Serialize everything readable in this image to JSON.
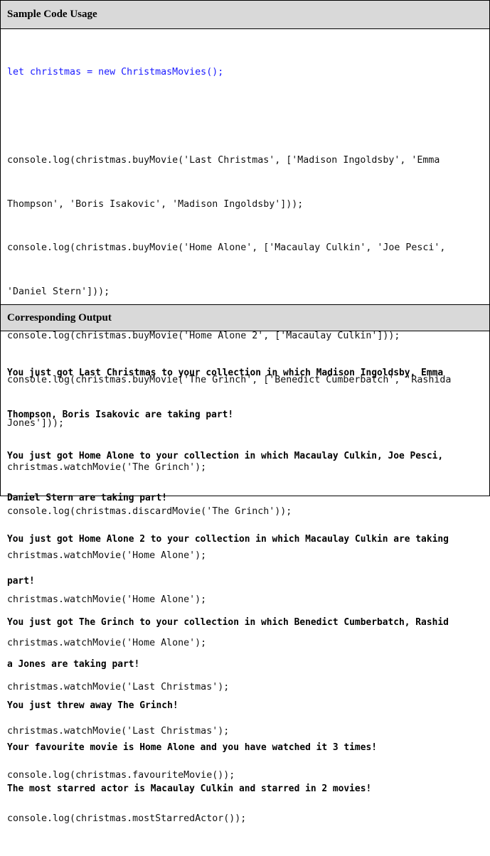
{
  "headers": {
    "usage": "Sample Code Usage",
    "output": "Corresponding Output"
  },
  "code": {
    "first_line": "let christmas = new ChristmasMovies();",
    "lines": [
      "console.log(christmas.buyMovie('Last Christmas', ['Madison Ingoldsby', 'Emma",
      "Thompson', 'Boris Isakovic', 'Madison Ingoldsby']));",
      "console.log(christmas.buyMovie('Home Alone', ['Macaulay Culkin', 'Joe Pesci',",
      "'Daniel Stern']));",
      "console.log(christmas.buyMovie('Home Alone 2', ['Macaulay Culkin']));",
      "console.log(christmas.buyMovie('The Grinch', ['Benedict Cumberbatch', 'Rashida",
      "Jones']));",
      "christmas.watchMovie('The Grinch');",
      "console.log(christmas.discardMovie('The Grinch'));",
      "christmas.watchMovie('Home Alone');",
      "christmas.watchMovie('Home Alone');",
      "christmas.watchMovie('Home Alone');",
      "christmas.watchMovie('Last Christmas');",
      "christmas.watchMovie('Last Christmas');",
      "console.log(christmas.favouriteMovie());",
      "console.log(christmas.mostStarredActor());"
    ]
  },
  "output": {
    "lines": [
      "You just got Last Christmas to your collection in which Madison Ingoldsby, Emma",
      "Thompson, Boris Isakovic are taking part!",
      "You just got Home Alone to your collection in which Macaulay Culkin, Joe Pesci,",
      "Daniel Stern are taking part!",
      "You just got Home Alone 2 to your collection in which Macaulay Culkin are taking",
      "part!",
      "You just got The Grinch to your collection in which Benedict Cumberbatch, Rashid",
      "a Jones are taking part!",
      "You just threw away The Grinch!",
      "Your favourite movie is Home Alone and you have watched it 3 times!",
      "The most starred actor is Macaulay Culkin and starred in 2 movies!"
    ]
  },
  "colors": {
    "header_bg": "#d9d9d9",
    "first_line_color": "#1a1aff"
  }
}
